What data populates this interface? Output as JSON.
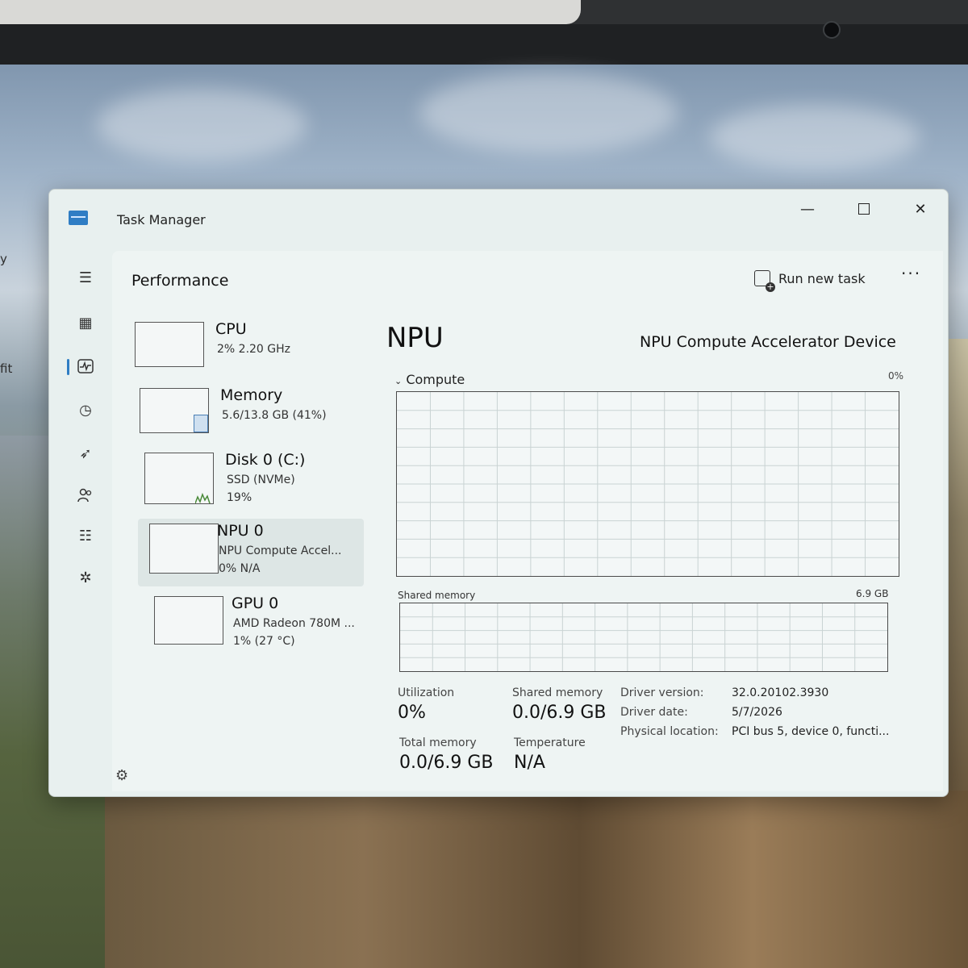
{
  "window": {
    "title": "Task Manager",
    "controls": {
      "minimize": "—",
      "close": "✕"
    }
  },
  "header": {
    "page_title": "Performance",
    "run_new_task": "Run new task",
    "more": "···"
  },
  "sidebar": {
    "icons": [
      "hamburger-icon",
      "processes-icon",
      "performance-icon",
      "app-history-icon",
      "startup-apps-icon",
      "users-icon",
      "details-icon",
      "services-icon",
      "settings-icon"
    ],
    "active": "performance"
  },
  "devices": [
    {
      "name": "CPU",
      "line1": "2% 2.20 GHz",
      "line2": ""
    },
    {
      "name": "Memory",
      "line1": "5.6/13.8 GB (41%)",
      "line2": ""
    },
    {
      "name": "Disk 0 (C:)",
      "line1": "SSD (NVMe)",
      "line2": "19%"
    },
    {
      "name": "NPU 0",
      "line1": "NPU Compute Accel...",
      "line2": "0% N/A"
    },
    {
      "name": "GPU 0",
      "line1": "AMD Radeon 780M ...",
      "line2": "1% (27 °C)"
    }
  ],
  "detail": {
    "title": "NPU",
    "device_name": "NPU Compute Accelerator Device",
    "compute_label": "Compute",
    "compute_pct": "0%",
    "shared_memory_label": "Shared memory",
    "shared_memory_max": "6.9 GB",
    "stats": {
      "utilization_label": "Utilization",
      "utilization_value": "0%",
      "shared_memory_label": "Shared memory",
      "shared_memory_value": "0.0/6.9 GB",
      "total_memory_label": "Total memory",
      "total_memory_value": "0.0/6.9 GB",
      "temperature_label": "Temperature",
      "temperature_value": "N/A"
    },
    "info": {
      "driver_version_label": "Driver version:",
      "driver_version_value": "32.0.20102.3930",
      "driver_date_label": "Driver date:",
      "driver_date_value": "5/7/2026",
      "physical_location_label": "Physical location:",
      "physical_location_value": "PCI bus 5, device 0, functi..."
    }
  },
  "desktop": {
    "left_text_1": "y",
    "left_text_2": "fit"
  },
  "colors": {
    "accent": "#2f7dc4",
    "window_bg": "#e8f0ef",
    "graph_border": "#4a4a4a"
  }
}
